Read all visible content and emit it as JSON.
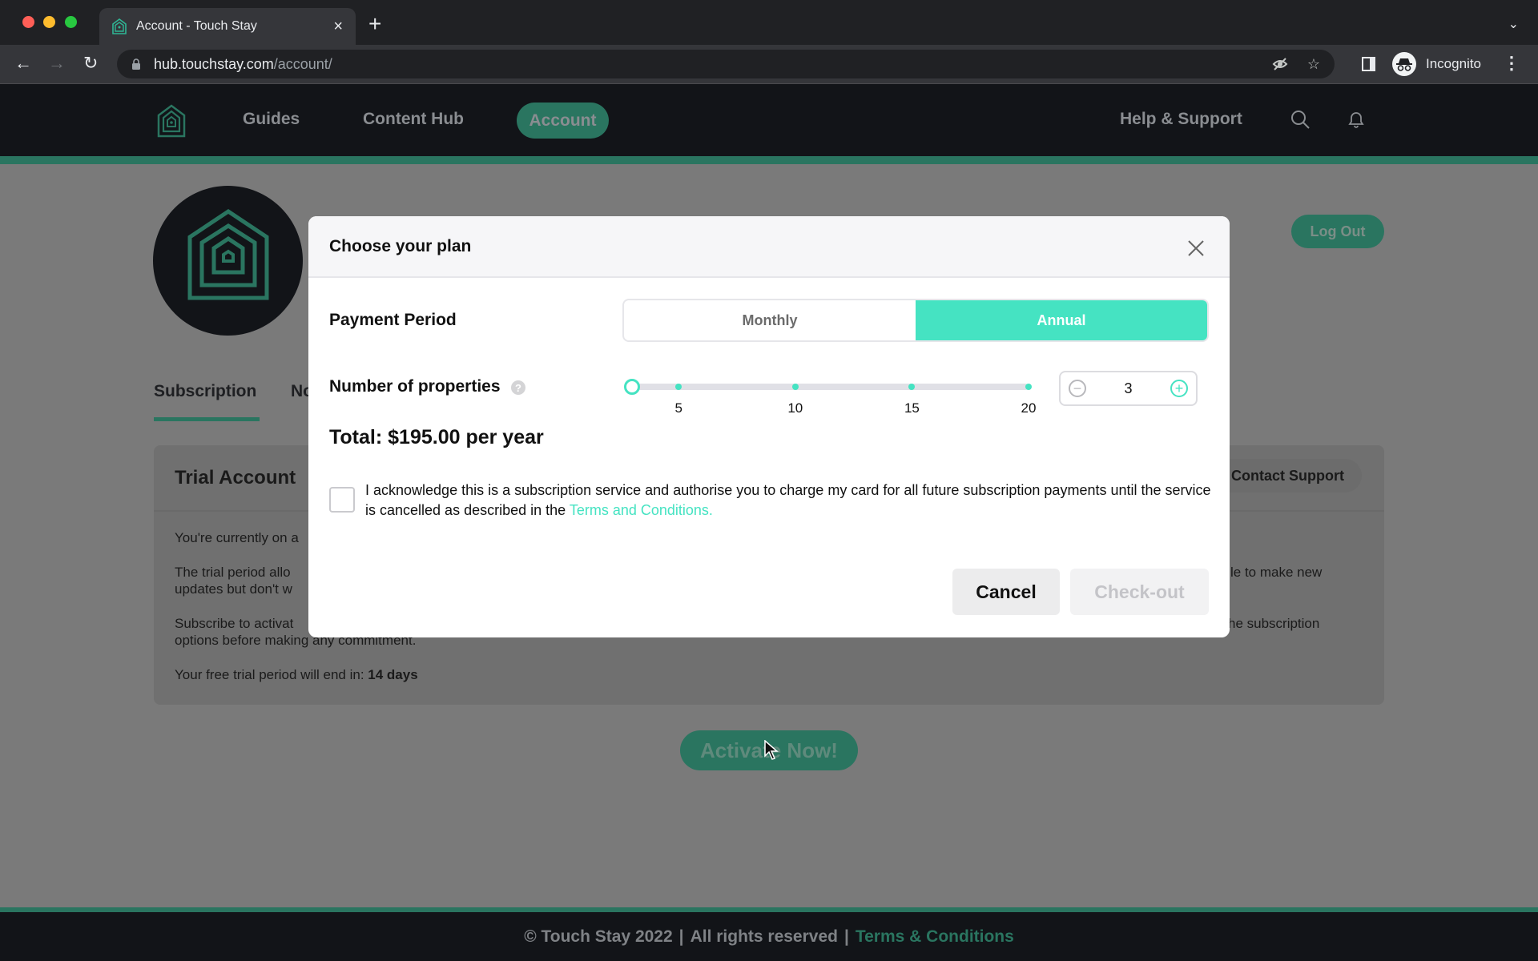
{
  "browser": {
    "tab_title": "Account - Touch Stay",
    "url_host": "hub.touchstay.com",
    "url_path": "/account/",
    "profile_label": "Incognito"
  },
  "header": {
    "nav": [
      {
        "label": "Guides"
      },
      {
        "label": "Content Hub"
      },
      {
        "label": "Account",
        "active": true
      }
    ],
    "help_label": "Help & Support"
  },
  "page": {
    "logout_label": "Log Out",
    "tabs": [
      {
        "label": "Subscription",
        "active": true
      },
      {
        "label": "No"
      }
    ],
    "card": {
      "title": "Trial Account",
      "contact_label": "Contact Support",
      "line1": "You're currently on a",
      "line2a": "The trial period allo",
      "line2b": "updates but don't w",
      "line2_right": "le to make new",
      "line3a": "Subscribe to activat",
      "line3b": "options before making any commitment.",
      "line3_right": "he subscription",
      "trial_prefix": "Your free trial period will end in: ",
      "trial_days": "14 days"
    },
    "activate_label": "Activate Now!"
  },
  "modal": {
    "title": "Choose your plan",
    "payment_period_label": "Payment Period",
    "period_options": [
      {
        "label": "Monthly",
        "selected": false
      },
      {
        "label": "Annual",
        "selected": true
      }
    ],
    "properties_label": "Number of properties",
    "help_glyph": "?",
    "slider": {
      "min": 3,
      "max": 20,
      "value": 3,
      "ticks": [
        "5",
        "10",
        "15",
        "20"
      ]
    },
    "stepper": {
      "minus": "−",
      "value": "3",
      "plus": "+"
    },
    "total": "Total: $195.00 per year",
    "ack_text": "I acknowledge this is a subscription service and authorise you to charge my card for all future subscription payments until the service is cancelled as described in the ",
    "ack_link": "Terms and Conditions.",
    "ack_checked": false,
    "cancel_label": "Cancel",
    "checkout_label": "Check-out"
  },
  "footer": {
    "copyright": "© Touch Stay 2022",
    "separator": "|",
    "rights": "All rights reserved",
    "terms_link": "Terms & Conditions"
  },
  "colors": {
    "accent": "#45e3c2",
    "accent_dimmed": "#2a7560",
    "header_bg": "#121418"
  }
}
